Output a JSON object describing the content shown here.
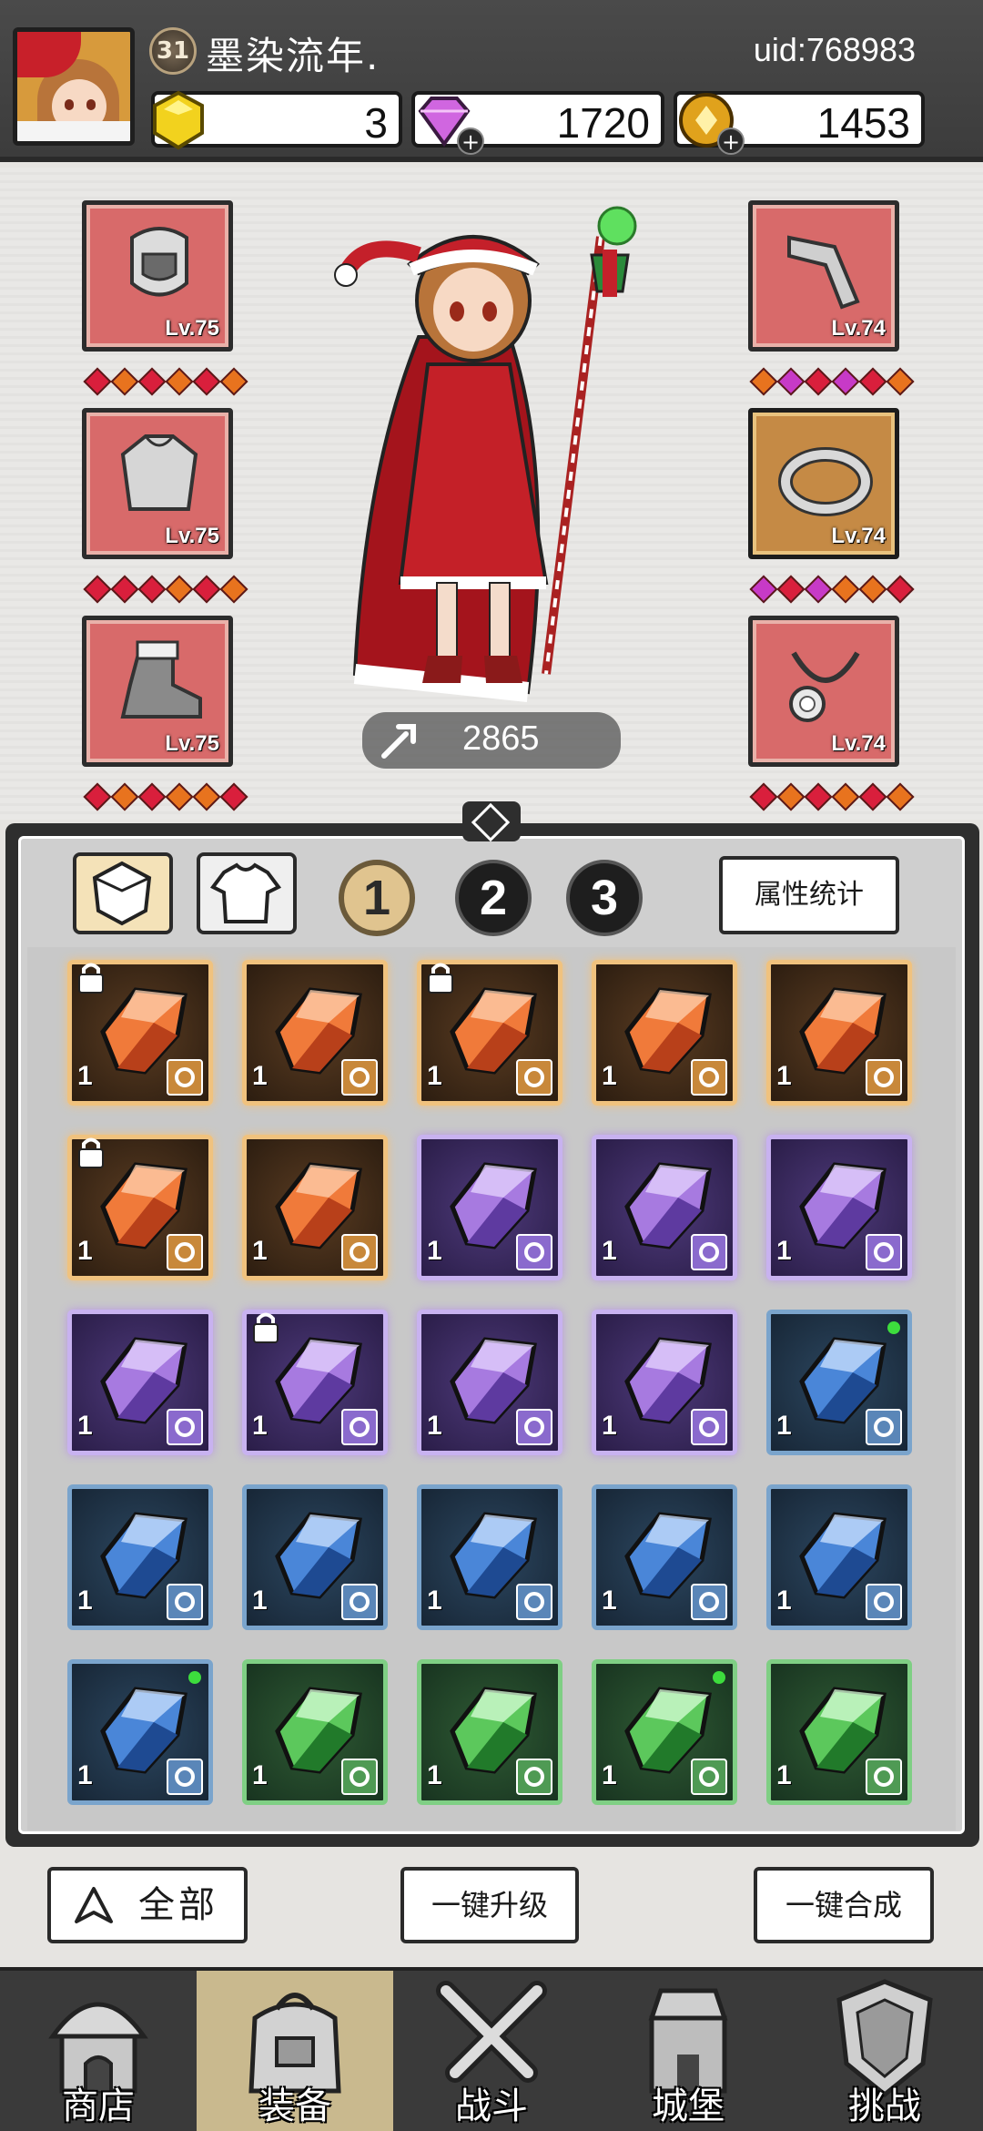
{
  "player": {
    "level": "31",
    "name": "墨染流年.",
    "uid": "uid:768983"
  },
  "currencies": [
    {
      "name": "gold-gem",
      "value": "3",
      "color": "#f2d21e"
    },
    {
      "name": "diamond",
      "value": "1720",
      "color": "#d066e0"
    },
    {
      "name": "coin",
      "value": "1453",
      "color": "#e0a21c"
    }
  ],
  "equipment": {
    "left": [
      {
        "item": "helmet-icon",
        "level": "Lv.75",
        "gems": [
          "r",
          "o",
          "r",
          "o",
          "r",
          "o"
        ]
      },
      {
        "item": "armor-icon",
        "level": "Lv.75",
        "gems": [
          "r",
          "r",
          "r",
          "o",
          "r",
          "o"
        ]
      },
      {
        "item": "boot-icon",
        "level": "Lv.75",
        "gems": [
          "r",
          "o",
          "r",
          "o",
          "o",
          "r"
        ]
      }
    ],
    "right": [
      {
        "item": "bracer-icon",
        "level": "Lv.74",
        "gems": [
          "o",
          "p",
          "r",
          "p",
          "r",
          "o"
        ]
      },
      {
        "item": "ring-icon",
        "level": "Lv.74",
        "gems": [
          "p",
          "r",
          "p",
          "o",
          "o",
          "r"
        ]
      },
      {
        "item": "necklace-icon",
        "level": "Lv.74",
        "gems": [
          "r",
          "o",
          "r",
          "o",
          "r",
          "o"
        ]
      }
    ]
  },
  "power": "2865",
  "tabs": {
    "pages": [
      "1",
      "2",
      "3"
    ],
    "active_page": "1",
    "stats_button": "属性统计"
  },
  "inventory": [
    [
      {
        "rarity": "orange",
        "qty": "1",
        "lock": true
      },
      {
        "rarity": "orange",
        "qty": "1"
      },
      {
        "rarity": "orange",
        "qty": "1",
        "lock": true
      },
      {
        "rarity": "orange",
        "qty": "1"
      },
      {
        "rarity": "orange",
        "qty": "1"
      }
    ],
    [
      {
        "rarity": "orange",
        "qty": "1",
        "lock": true
      },
      {
        "rarity": "orange",
        "qty": "1"
      },
      {
        "rarity": "purple",
        "qty": "1"
      },
      {
        "rarity": "purple",
        "qty": "1"
      },
      {
        "rarity": "purple",
        "qty": "1"
      }
    ],
    [
      {
        "rarity": "purple",
        "qty": "1"
      },
      {
        "rarity": "purple",
        "qty": "1",
        "lock": true
      },
      {
        "rarity": "purple",
        "qty": "1"
      },
      {
        "rarity": "purple",
        "qty": "1"
      },
      {
        "rarity": "blue",
        "qty": "1",
        "dot": true
      }
    ],
    [
      {
        "rarity": "blue",
        "qty": "1"
      },
      {
        "rarity": "blue",
        "qty": "1"
      },
      {
        "rarity": "blue",
        "qty": "1"
      },
      {
        "rarity": "blue",
        "qty": "1"
      },
      {
        "rarity": "blue",
        "qty": "1"
      }
    ],
    [
      {
        "rarity": "blue",
        "qty": "1",
        "dot": true
      },
      {
        "rarity": "green",
        "qty": "1"
      },
      {
        "rarity": "green",
        "qty": "1"
      },
      {
        "rarity": "green",
        "qty": "1",
        "dot": true
      },
      {
        "rarity": "green",
        "qty": "1"
      }
    ]
  ],
  "actions": {
    "filter_all": "全部",
    "upgrade_all": "一键升级",
    "combine_all": "一键合成"
  },
  "nav": [
    {
      "label": "商店",
      "icon": "shop-icon"
    },
    {
      "label": "装备",
      "icon": "bag-icon",
      "active": true
    },
    {
      "label": "战斗",
      "icon": "swords-icon"
    },
    {
      "label": "城堡",
      "icon": "castle-icon"
    },
    {
      "label": "挑战",
      "icon": "shield-icon"
    }
  ],
  "colors": {
    "orange_border": "#f0c27e",
    "purple_border": "#c8b2f0",
    "blue_border": "#7aa4cc",
    "green_border": "#7fcf84",
    "slot_red": "#d86a6a"
  }
}
